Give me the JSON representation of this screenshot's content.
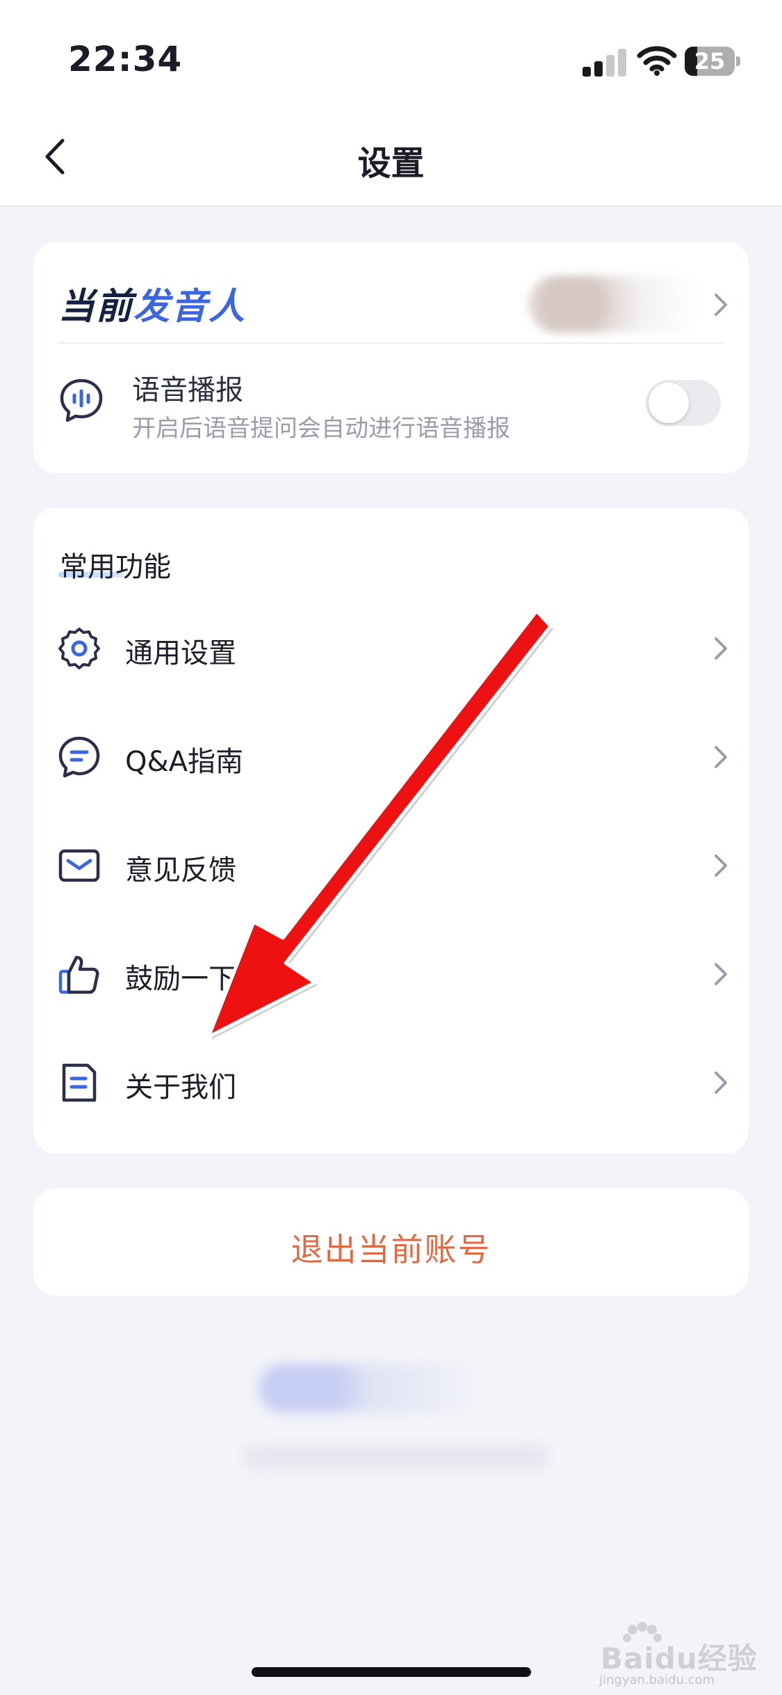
{
  "status_bar": {
    "time": "22:34",
    "battery": "25"
  },
  "nav": {
    "title": "设置"
  },
  "speaker_card": {
    "label_part1": "当前",
    "label_part2": "发音人",
    "voice_title": "语音播报",
    "voice_subtitle": "开启后语音提问会自动进行语音播报",
    "voice_toggle_on": false
  },
  "functions": {
    "title": "常用功能",
    "items": [
      {
        "label": "通用设置",
        "icon": "gear-icon"
      },
      {
        "label": "Q&A指南",
        "icon": "chat-bubble-icon"
      },
      {
        "label": "意见反馈",
        "icon": "mail-icon"
      },
      {
        "label": "鼓励一下",
        "icon": "thumbs-up-icon"
      },
      {
        "label": "关于我们",
        "icon": "document-icon"
      }
    ]
  },
  "logout": {
    "label": "退出当前账号"
  },
  "watermark": {
    "brand": "Baidu经验",
    "url": "jingyan.baidu.com"
  },
  "colors": {
    "accent_blue": "#3c66e0",
    "logout_orange": "#e06a44",
    "annotation_arrow": "#ee1111",
    "page_background": "#f3f4f9"
  }
}
